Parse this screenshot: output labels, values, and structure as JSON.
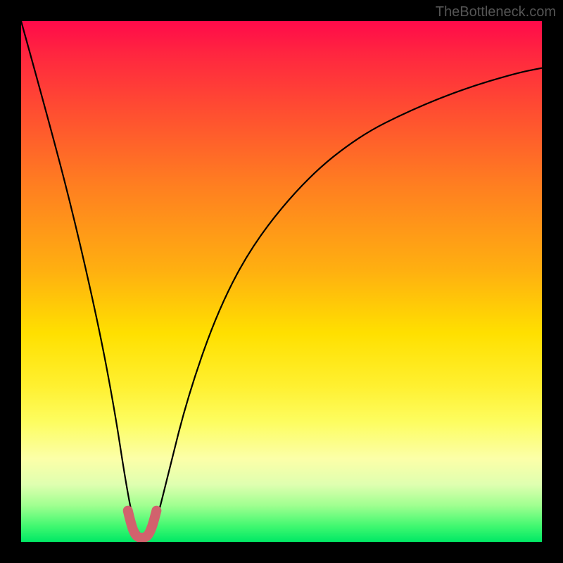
{
  "watermark": "TheBottleneck.com",
  "chart_data": {
    "type": "line",
    "title": "",
    "xlabel": "",
    "ylabel": "",
    "xlim": [
      0,
      100
    ],
    "ylim": [
      0,
      100
    ],
    "series": [
      {
        "name": "curve",
        "x": [
          0,
          5,
          10,
          15,
          18,
          20,
          21.5,
          23,
          24.5,
          26,
          28,
          32,
          38,
          45,
          55,
          65,
          75,
          85,
          95,
          100
        ],
        "y": [
          100,
          82,
          63,
          41,
          25,
          12,
          4,
          1,
          1,
          4,
          12,
          28,
          45,
          58,
          70,
          78,
          83,
          87,
          90,
          91
        ]
      },
      {
        "name": "highlight",
        "x": [
          20.5,
          21.2,
          22,
          22.8,
          23.6,
          24.4,
          25.2,
          26
        ],
        "y": [
          6,
          3,
          1.2,
          0.8,
          0.8,
          1.2,
          3,
          6
        ]
      }
    ],
    "gradient_background": {
      "top_color": "#ff0a4a",
      "mid_color": "#ffe000",
      "bottom_color": "#00e865"
    }
  }
}
